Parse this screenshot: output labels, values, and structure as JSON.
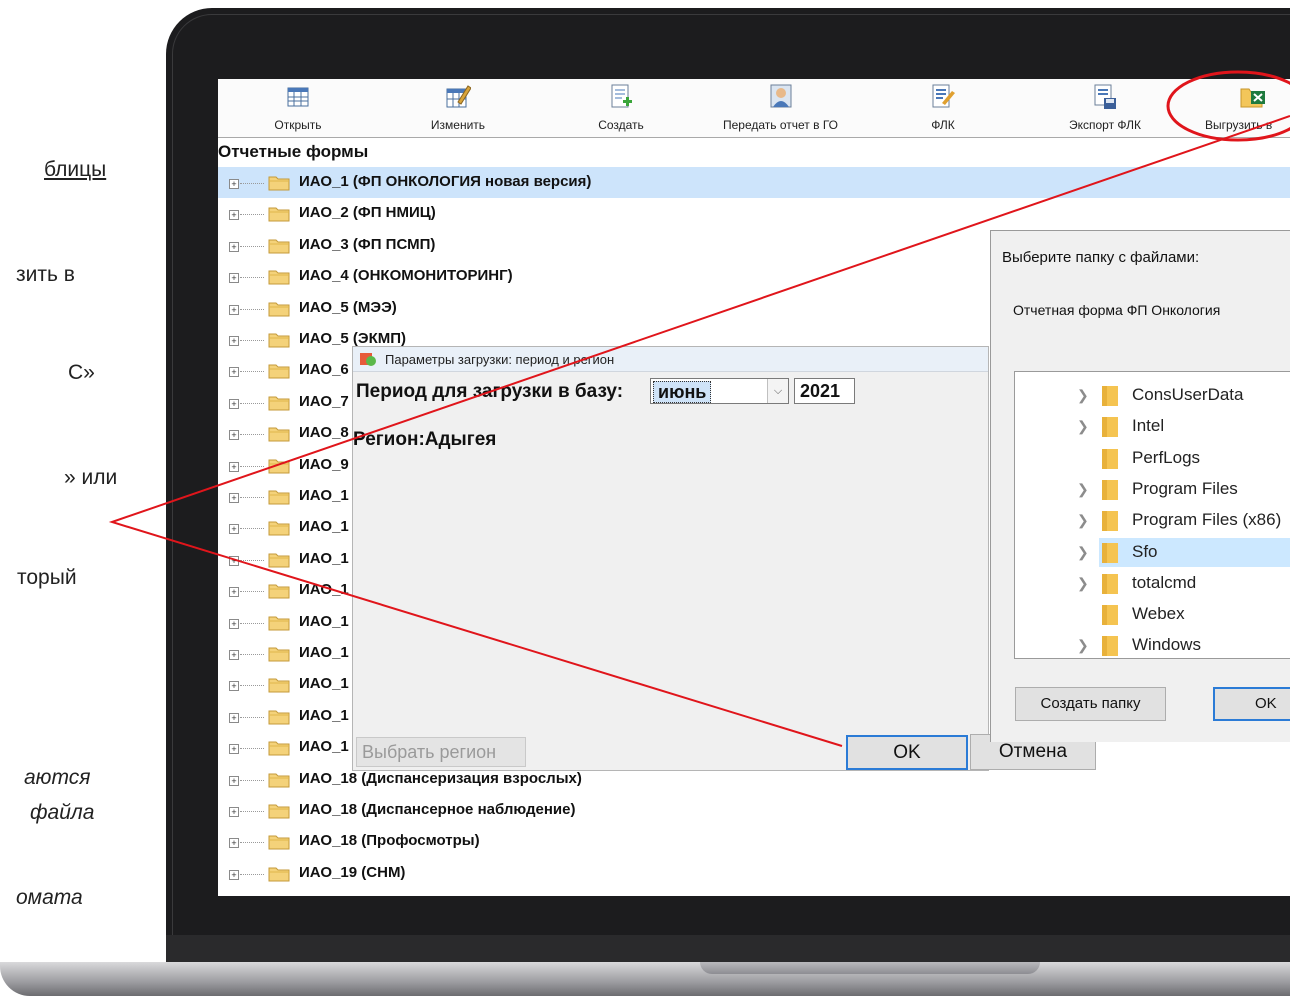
{
  "slide_text": {
    "l1": "блицы",
    "l2": "зить в",
    "l3": "С»",
    "l4": "»  или",
    "l5": "торый",
    "l6": "аются",
    "l7": "файла",
    "l8": "омата"
  },
  "toolbar": {
    "open": "Открыть",
    "edit": "Изменить",
    "create": "Создать",
    "send": "Передать отчет в ГО",
    "flk": "ФЛК",
    "export_flk": "Экспорт ФЛК",
    "upload": "Выгрузить в"
  },
  "tree": {
    "title": "Отчетные формы",
    "items": [
      "ИАО_1 (ФП ОНКОЛОГИЯ новая версия)",
      "ИАО_2 (ФП НМИЦ)",
      "ИАО_3 (ФП ПСМП)",
      "ИАО_4 (ОНКОМОНИТОРИНГ)",
      "ИАО_5 (МЭЭ)",
      "ИАО_5 (ЭКМП)",
      "ИАО_6",
      "ИАО_7",
      "ИАО_8",
      "ИАО_9",
      "ИАО_1",
      "ИАО_1",
      "ИАО_1",
      "ИАО_1",
      "ИАО_1",
      "ИАО_1",
      "ИАО_1",
      "ИАО_1",
      "ИАО_1",
      "ИАО_18 (Диспансеризация взрослых)",
      "ИАО_18 (Диспансерное наблюдение)",
      "ИАО_18 (Профосмотры)",
      "ИАО_19 (СНМ)"
    ]
  },
  "load_dialog": {
    "title": "Параметры загрузки: период и регион",
    "period_label": "Период для загрузки в базу:",
    "month": "июнь",
    "year": "2021",
    "region": "Регион:Адыгея",
    "select_region": "Выбрать регион",
    "ok": "OK",
    "cancel": "Отмена"
  },
  "folder_dialog": {
    "title": "Выберите папку с файлами:",
    "subtitle": "Отчетная форма ФП Онкология",
    "folders": [
      {
        "name": "ConsUserData",
        "expandable": true
      },
      {
        "name": "Intel",
        "expandable": true
      },
      {
        "name": "PerfLogs",
        "expandable": false
      },
      {
        "name": "Program Files",
        "expandable": true
      },
      {
        "name": "Program Files (x86)",
        "expandable": true
      },
      {
        "name": "Sfo",
        "expandable": true,
        "selected": true
      },
      {
        "name": "totalcmd",
        "expandable": true
      },
      {
        "name": "Webex",
        "expandable": false
      },
      {
        "name": "Windows",
        "expandable": true
      }
    ],
    "new_folder": "Создать папку",
    "ok": "OK"
  },
  "colors": {
    "annotation": "#e0151b",
    "selection": "#cde4fb",
    "accent_border": "#2b7bd6",
    "folder": "#f5c451"
  }
}
